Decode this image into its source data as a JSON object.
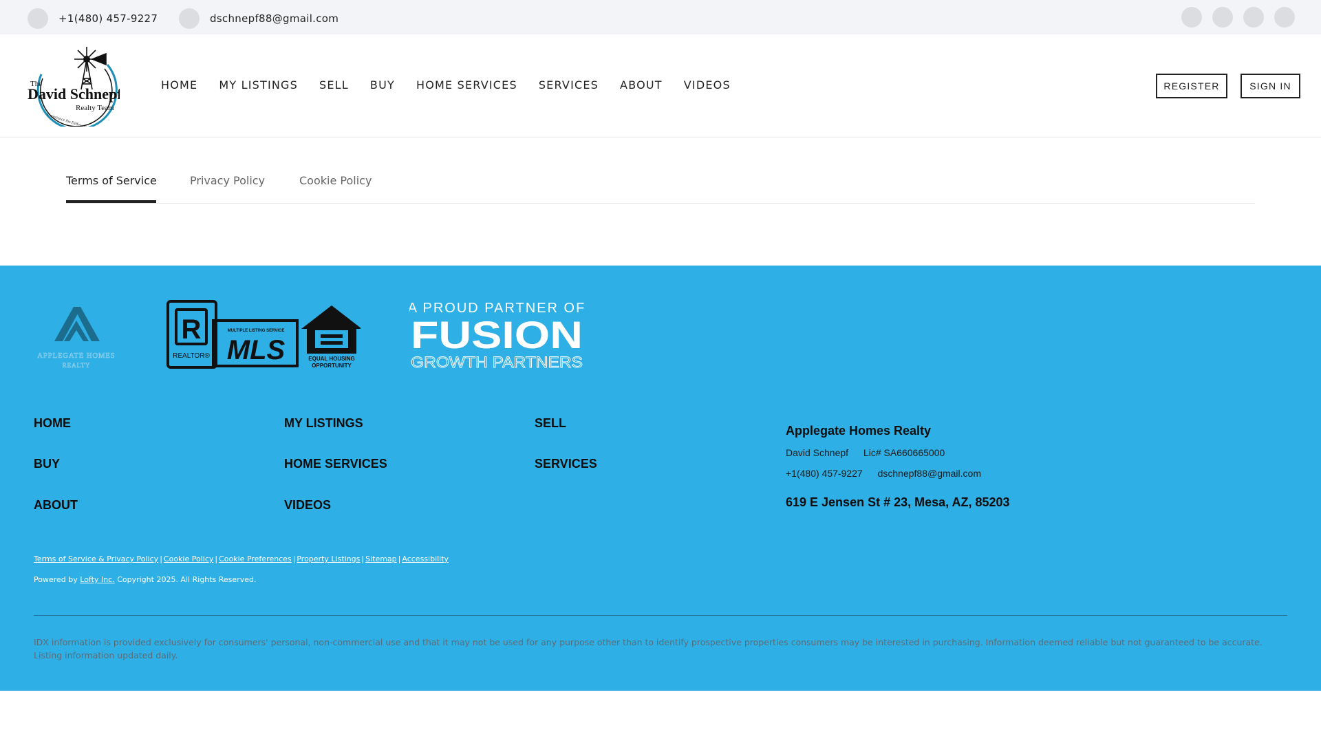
{
  "topbar": {
    "phone": "+1(480) 457-9227",
    "email": "dschnepf88@gmail.com",
    "social_icons": [
      "social-icon-1",
      "social-icon-2",
      "social-icon-3",
      "social-icon-4"
    ]
  },
  "logo": {
    "line_the": "The",
    "line_name": "David Schnepf",
    "line_team": "Realty Team",
    "tagline": "Experience the Difference"
  },
  "nav": {
    "items": [
      "HOME",
      "MY LISTINGS",
      "SELL",
      "BUY",
      "HOME SERVICES",
      "SERVICES",
      "ABOUT",
      "VIDEOS"
    ]
  },
  "auth": {
    "register_label": "REGISTER",
    "signin_label": "SIGN IN"
  },
  "tabs": {
    "items": [
      "Terms of Service",
      "Privacy Policy",
      "Cookie Policy"
    ],
    "active": "Terms of Service"
  },
  "partners": {
    "applegate_name": "APPLEGATE HOMES",
    "applegate_sub": "REALTY",
    "realtor_mark": "R",
    "realtor_label": "REALTOR®",
    "mls_small": "MULTIPLE LISTING SERVICE",
    "mls_label": "MLS",
    "eho_line1": "EQUAL HOUSING",
    "eho_line2": "OPPORTUNITY",
    "fusion_top": "A PROUD PARTNER OF",
    "fusion_main": "FUSION",
    "fusion_sub": "GROWTH PARTNERS"
  },
  "footer_nav": {
    "col1": [
      "HOME",
      "BUY",
      "ABOUT"
    ],
    "col2": [
      "MY LISTINGS",
      "HOME SERVICES",
      "VIDEOS"
    ],
    "col3": [
      "SELL",
      "SERVICES"
    ]
  },
  "office": {
    "name": "Applegate Homes Realty",
    "agent": "David Schnepf",
    "license": "Lic# SA660665000",
    "phone": "+1(480) 457-9227",
    "email": "dschnepf88@gmail.com",
    "address": "619 E Jensen St # 23, Mesa, AZ, 85203"
  },
  "legal_links": [
    "Terms of Service & Privacy Policy",
    "Cookie Policy",
    "Cookie Preferences",
    "Property Listings",
    "Sitemap",
    "Accessibility"
  ],
  "powered": {
    "prefix": "Powered by",
    "link": "Lofty Inc.",
    "suffix": "Copyright 2025. All Rights Reserved."
  },
  "disclaimer": "IDX information is provided exclusively for consumers' personal, non-commercial use and that it may not be used for any purpose other than to identify prospective properties consumers may be interested in purchasing. Information deemed reliable but not guaranteed to be accurate. Listing information updated daily.",
  "colors": {
    "footer_bg": "#2eb0e6",
    "topbar_bg": "#f3f4f7",
    "logo_accent": "#1d8fb8",
    "applegate_logo": "#1c6d8d"
  }
}
